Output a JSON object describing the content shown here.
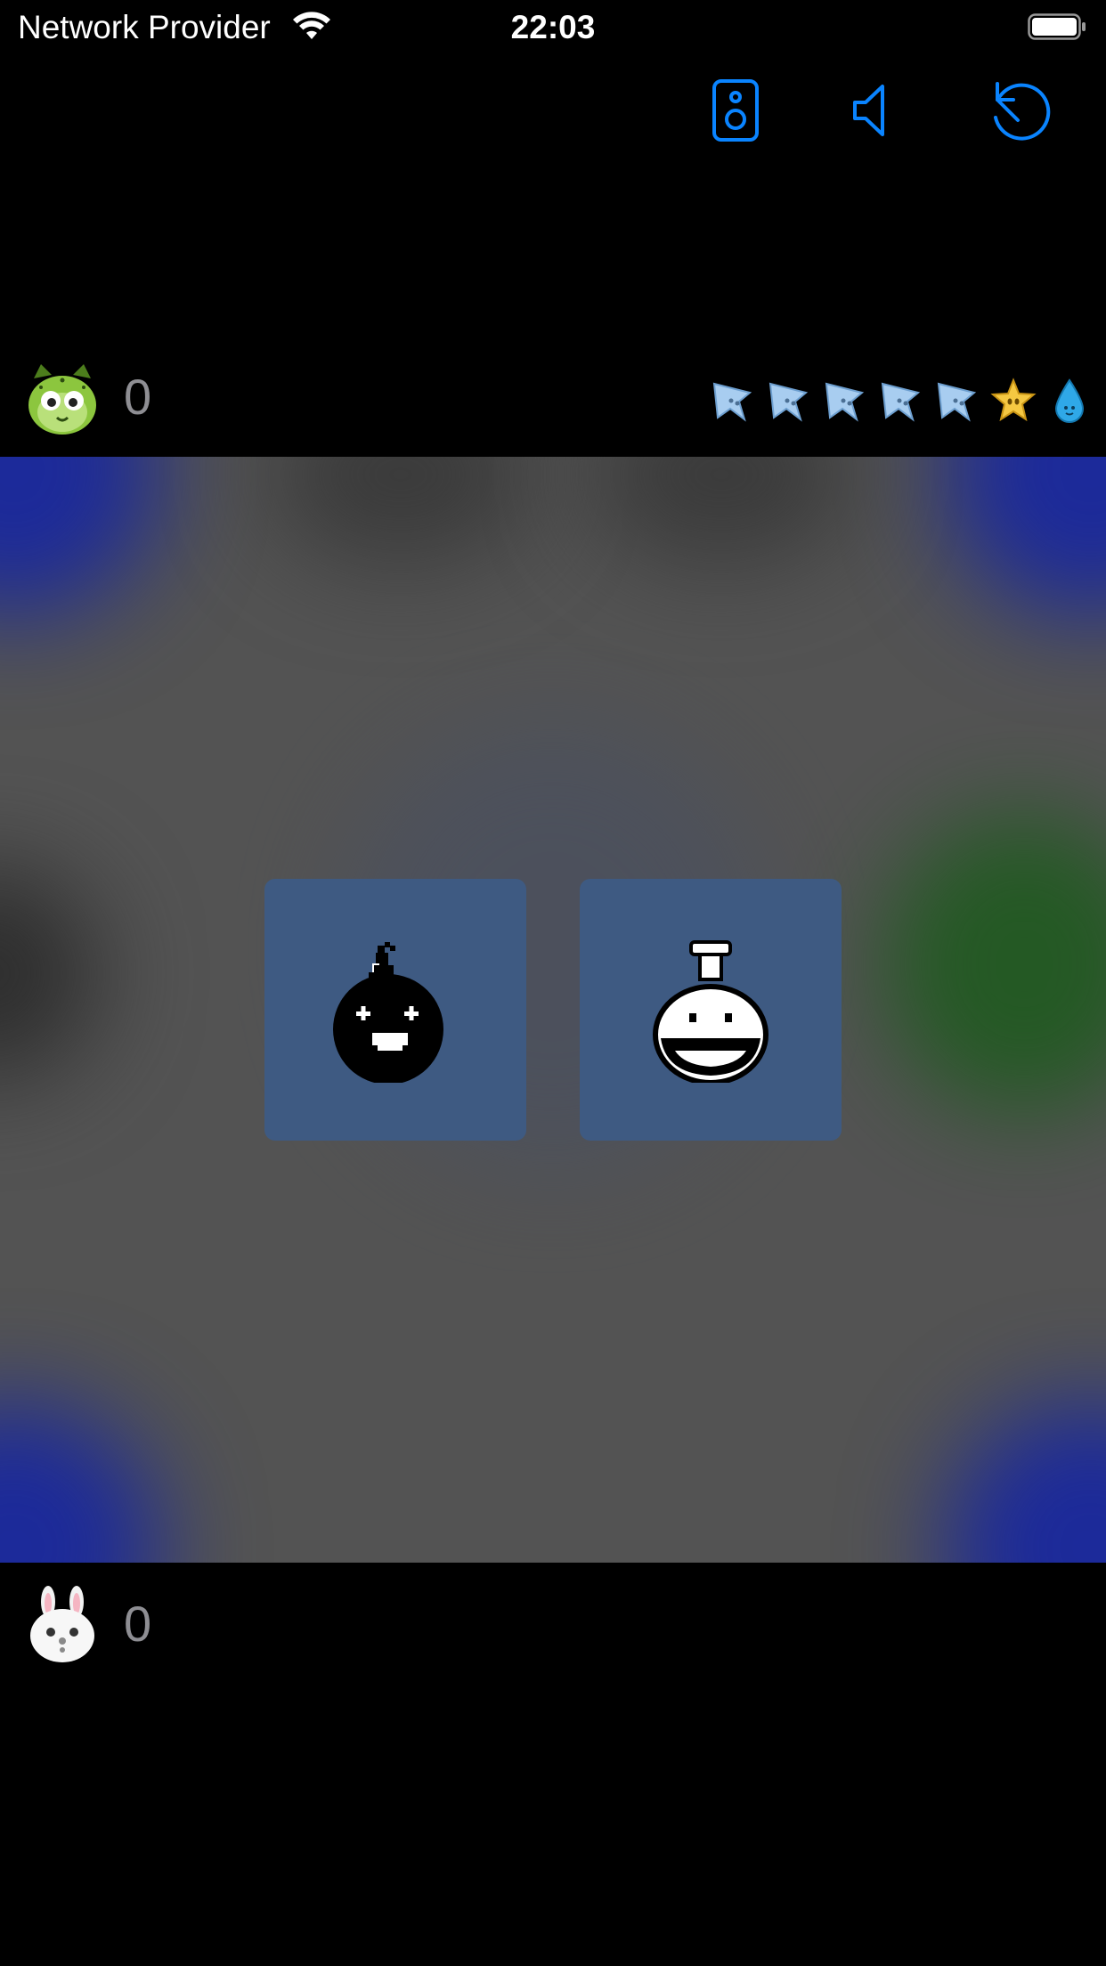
{
  "status_bar": {
    "carrier": "Network Provider",
    "time": "22:03"
  },
  "toolbar": {
    "icons": [
      "speaker-icon",
      "volume-icon",
      "reset-icon"
    ],
    "accent": "#0a84ff"
  },
  "opponent": {
    "avatar": "green-cat-avatar",
    "score": "0",
    "tokens": [
      "blue-star",
      "blue-star",
      "blue-star",
      "blue-star",
      "blue-star",
      "gold-star",
      "water-drop"
    ]
  },
  "player": {
    "avatar": "white-bunny-avatar",
    "score": "0"
  },
  "board": {
    "cards": [
      {
        "icon": "bomb-icon"
      },
      {
        "icon": "flask-icon"
      }
    ]
  }
}
